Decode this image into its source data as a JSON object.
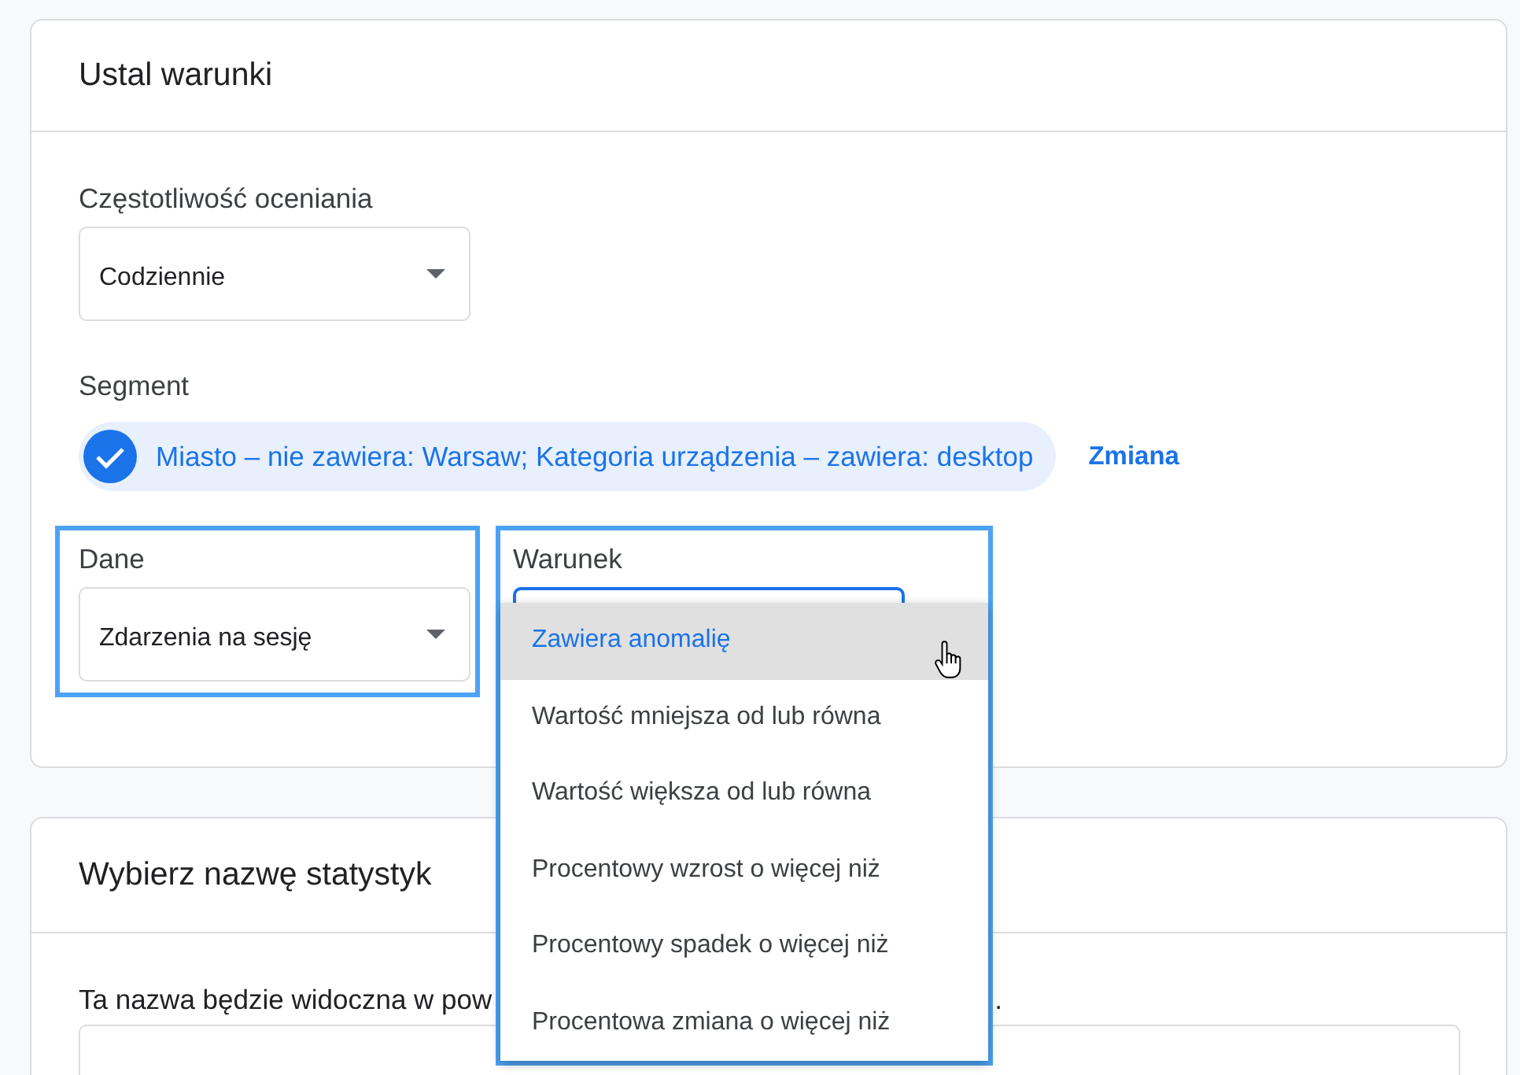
{
  "conditions_card": {
    "title": "Ustal warunki",
    "frequency": {
      "label": "Częstotliwość oceniania",
      "value": "Codziennie"
    },
    "segment": {
      "label": "Segment",
      "chip": {
        "text": "Miasto – nie zawiera: Warsaw; Kategoria urządzenia – zawiera: desktop",
        "checked": true
      },
      "change_link": "Zmiana"
    },
    "data_field": {
      "label": "Dane",
      "value": "Zdarzenia na sesję",
      "highlighted": true
    },
    "condition_field": {
      "label": "Warunek",
      "focused": true,
      "highlighted": true,
      "expanded": true,
      "options": [
        {
          "label": "Zawiera anomalię",
          "selected": true
        },
        {
          "label": "Wartość mniejsza od lub równa",
          "selected": false
        },
        {
          "label": "Wartość większa od lub równa",
          "selected": false
        },
        {
          "label": "Procentowy wzrost o więcej niż",
          "selected": false
        },
        {
          "label": "Procentowy spadek o więcej niż",
          "selected": false
        },
        {
          "label": "Procentowa zmiana o więcej niż",
          "selected": false
        }
      ]
    }
  },
  "name_card": {
    "title": "Wybierz nazwę statystyk",
    "description_fragments": [
      "Ta nazwa będzie widoczna w pow",
      "."
    ]
  }
}
